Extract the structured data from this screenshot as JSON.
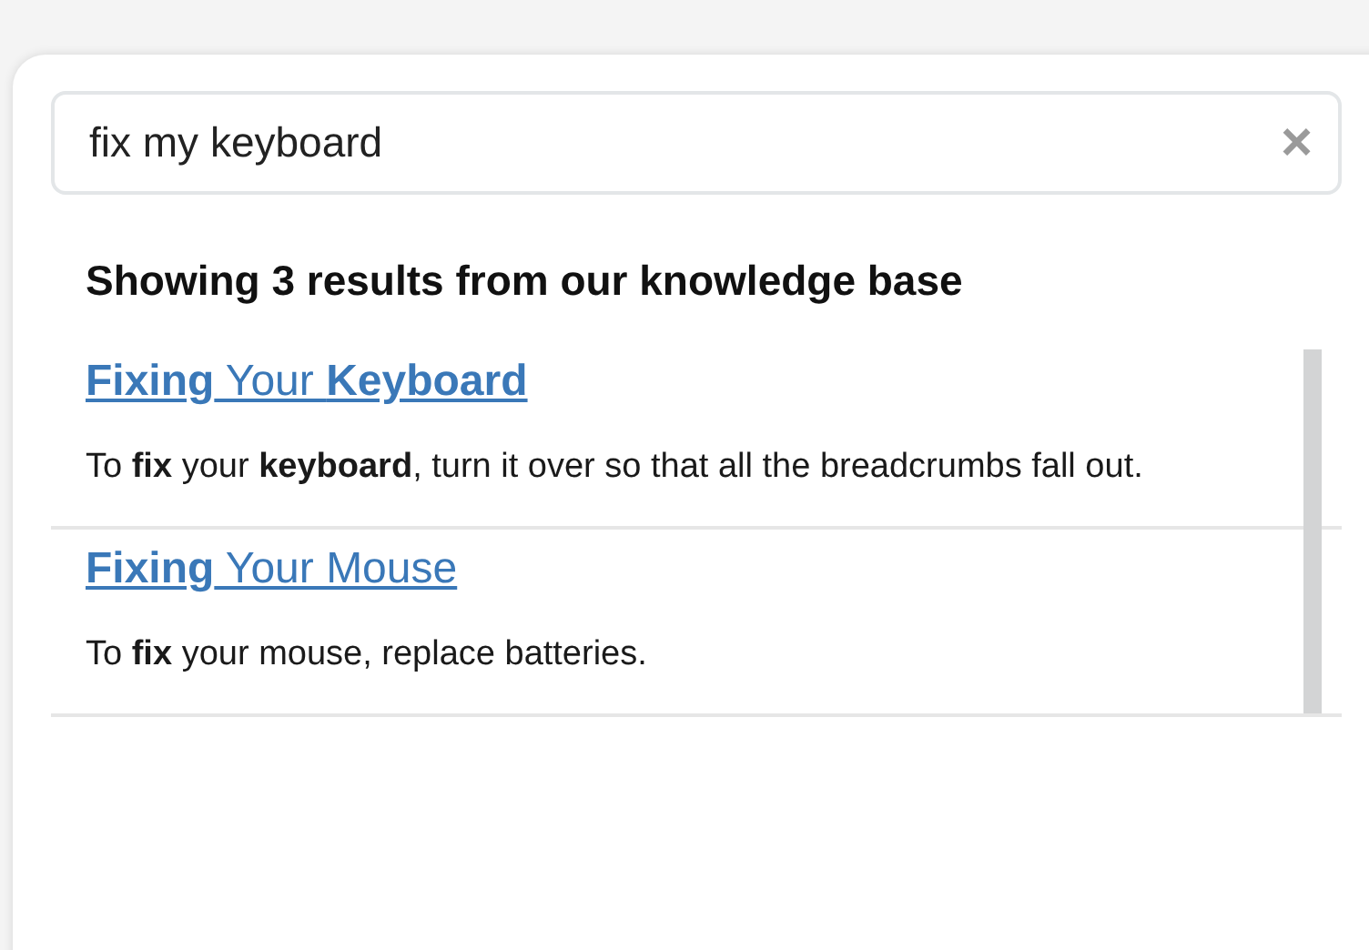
{
  "search": {
    "value": "fix my keyboard",
    "clear_icon": "×"
  },
  "heading": "Showing 3 results from our knowledge base",
  "results": [
    {
      "title": "**Fixing** Your **Keyboard**",
      "description": "To **fix** your **keyboard**, turn it over so that all the breadcrumbs fall out."
    },
    {
      "title": "**Fixing** Your Mouse",
      "description": "To **fix** your mouse, replace batteries."
    }
  ]
}
